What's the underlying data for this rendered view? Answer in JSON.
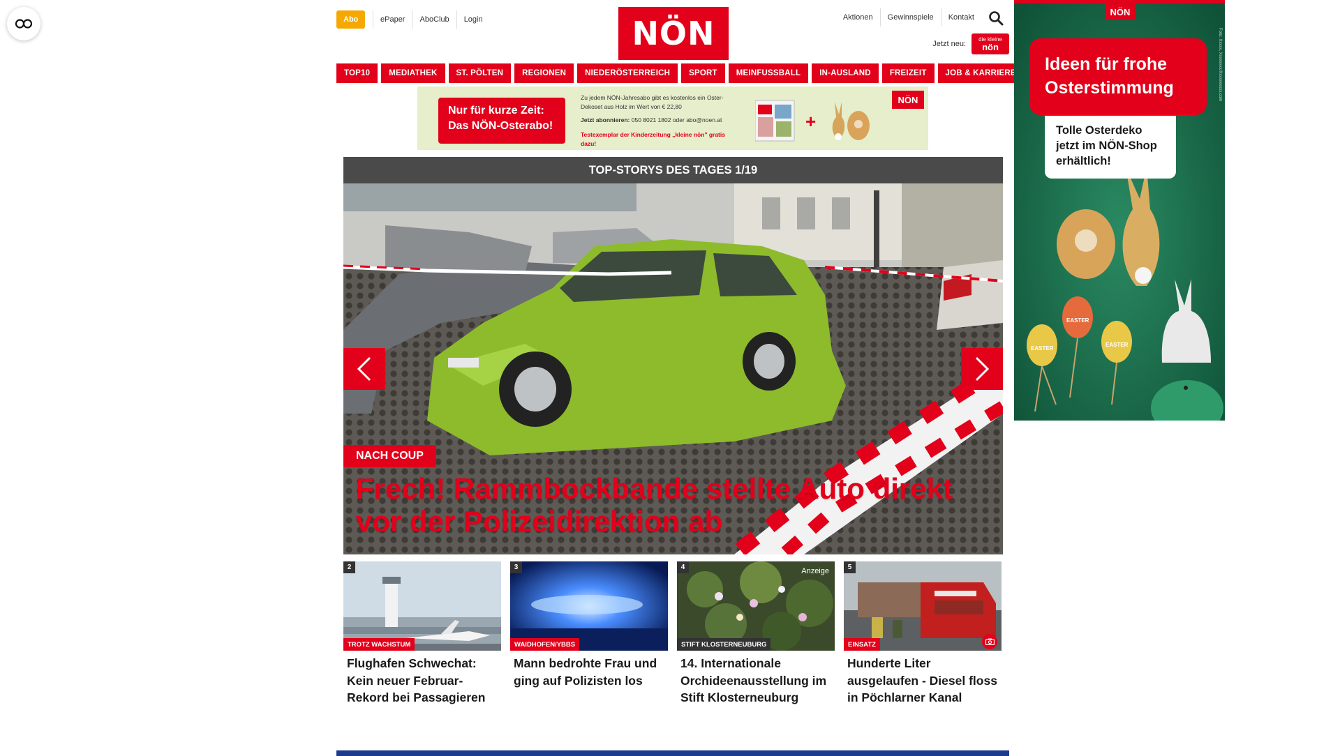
{
  "header": {
    "abo_label": "Abo",
    "left_links": [
      "ePaper",
      "AboClub",
      "Login"
    ],
    "logo_text": "NÖN",
    "right_links": [
      "Aktionen",
      "Gewinnspiele",
      "Kontakt"
    ],
    "jetzt_label": "Jetzt neu:",
    "jetzt_badge_top": "die kleine",
    "jetzt_badge_main": "nön"
  },
  "nav": {
    "items": [
      "TOP10",
      "MEDIATHEK",
      "ST. PÖLTEN",
      "REGIONEN",
      "NIEDERÖSTERREICH",
      "SPORT",
      "MEINFUSSBALL",
      "IN-AUSLAND",
      "FREIZEIT",
      "JOB & KARRIERE"
    ]
  },
  "banner": {
    "headline_1": "Nur für kurze Zeit:",
    "headline_2": "Das NÖN-Osterabo!",
    "text_1": "Zu jedem NÖN-Jahresabo gibt es kostenlos ein Oster-Dekoset aus Holz im Wert von € 22,80",
    "text_2_bold": "Jetzt abonnieren:",
    "text_2": " 050 8021 1802 oder abo@noen.at",
    "text_3": "Testexemplar der Kinderzeitung „kleine nön\" gratis dazu!",
    "logo": "NÖN",
    "plus": "+"
  },
  "hero": {
    "header": "TOP-STORYS DES TAGES 1/19",
    "tag": "NACH COUP",
    "title": "Frech! Rammbockbande stellte Auto direkt vor der Polizeidirektion ab"
  },
  "teasers": [
    {
      "num": "2",
      "category": "TROTZ WACHSTUM",
      "title": "Flughafen Schwechat: Kein neuer Februar-Rekord bei Passagieren"
    },
    {
      "num": "3",
      "category": "WAIDHOFEN/YBBS",
      "title": "Mann bedrohte Frau und ging auf Polizisten los"
    },
    {
      "num": "4",
      "category": "STIFT KLOSTERNEUBURG",
      "title": "14. Internationale Orchideenausstellung im Stift Klosterneuburg",
      "badge": "Anzeige"
    },
    {
      "num": "5",
      "category": "EINSATZ",
      "title": "Hunderte Liter ausgelaufen - Diesel floss in Pöchlarner Kanal"
    }
  ],
  "side_ad": {
    "logo": "NÖN",
    "headline": "Ideen für frohe Osterstimmung",
    "subline": "Tolle Osterdeko jetzt im NÖN-Shop erhältlich!",
    "egg_text": "EASTER",
    "credit": "Foto: Xxxxx, Xxxxxxxx/Xxxxxxxxxx.com"
  },
  "colors": {
    "brand_red": "#e2001a",
    "abo_orange": "#f5a800",
    "hero_header_gray": "#4a4a4a",
    "side_ad_green": "#1b6e4e",
    "footer_blue": "#1c3b8f"
  }
}
